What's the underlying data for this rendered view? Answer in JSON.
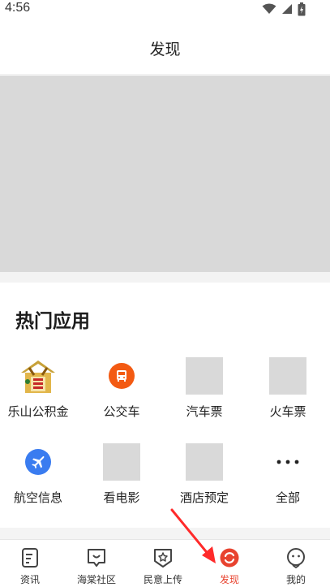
{
  "status_bar": {
    "time": "4:56",
    "icons": [
      "wifi-icon",
      "signal-icon",
      "battery-icon"
    ]
  },
  "header": {
    "title": "发现"
  },
  "hot_apps": {
    "title": "热门应用",
    "items": [
      {
        "label": "乐山公积金",
        "icon": "provident-fund-logo"
      },
      {
        "label": "公交车",
        "icon": "bus-icon"
      },
      {
        "label": "汽车票",
        "icon": "placeholder"
      },
      {
        "label": "火车票",
        "icon": "placeholder"
      },
      {
        "label": "航空信息",
        "icon": "airplane-icon"
      },
      {
        "label": "看电影",
        "icon": "placeholder"
      },
      {
        "label": "酒店预定",
        "icon": "placeholder"
      },
      {
        "label": "全部",
        "icon": "more-dots-icon"
      }
    ],
    "logo_text": "公积金"
  },
  "tabbar": {
    "tabs": [
      {
        "label": "资讯",
        "icon": "news-icon",
        "active": false
      },
      {
        "label": "海棠社区",
        "icon": "community-icon",
        "active": false
      },
      {
        "label": "民意上传",
        "icon": "badge-star-icon",
        "active": false
      },
      {
        "label": "发现",
        "icon": "discover-icon",
        "active": true
      },
      {
        "label": "我的",
        "icon": "profile-icon",
        "active": false
      }
    ]
  },
  "colors": {
    "accent": "#e8432f",
    "bus_orange": "#f35a12",
    "airplane_blue": "#3a7cf0",
    "placeholder_gray": "#d9d9d9"
  }
}
